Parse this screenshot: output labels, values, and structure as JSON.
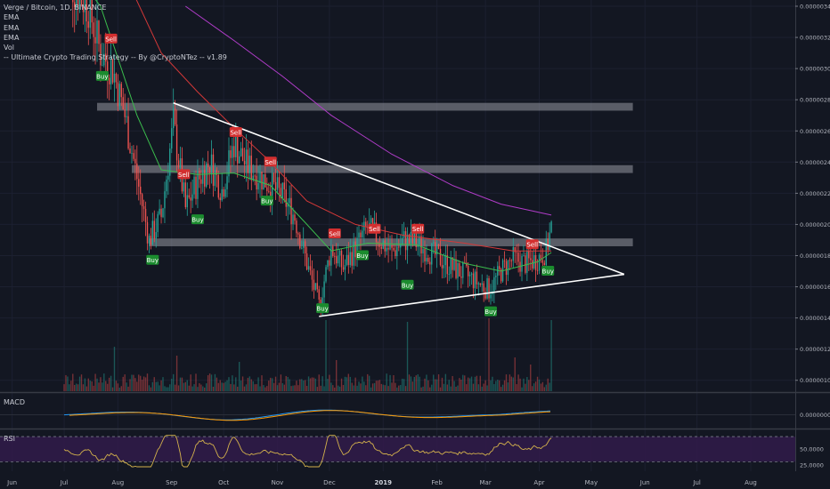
{
  "header": {
    "title": "Verge / Bitcoin, 1D, BINANCE",
    "indicators": [
      "EMA",
      "EMA",
      "EMA",
      "Vol",
      "-- Ultimate Crypto Trading Strategy -- By @CryptoNTez -- v1.89"
    ]
  },
  "panes": {
    "macd_label": "MACD",
    "rsi_label": "RSI"
  },
  "colors": {
    "background": "#131722",
    "up": "#26a69a",
    "down": "#ef5350",
    "ema_fast": "#3bbd4d",
    "ema_mid": "#d23838",
    "ema_slow": "#b03cc8",
    "trendline": "#ffffff",
    "sell": "#d32f2f",
    "buy": "#1b8c2e",
    "macd": "#2196f3",
    "signal": "#ff9800",
    "rsi": "#d4b24c",
    "rsi_band": "#311b4a"
  },
  "chart_data": {
    "type": "candlestick",
    "title": "Verge / Bitcoin, 1D, BINANCE",
    "x_ticks": [
      "Jun",
      "Jul",
      "Aug",
      "Sep",
      "Oct",
      "Nov",
      "Dec",
      "2019",
      "Feb",
      "Mar",
      "Apr",
      "May",
      "Jun",
      "Jul",
      "Aug"
    ],
    "price_axis": {
      "ticks": [
        "0.00000340",
        "0.00000320",
        "0.00000300",
        "0.00000280",
        "0.00000260",
        "0.00000240",
        "0.00000220",
        "0.00000200",
        "0.00000180",
        "0.00000160",
        "0.00000140",
        "0.00000120",
        "0.00000100"
      ],
      "ylim": [
        9.3e-07,
        3.44e-06
      ]
    },
    "macd_axis": {
      "ticks": [
        "0.00000000"
      ]
    },
    "rsi_axis": {
      "ticks": [
        "50.0000",
        "25.0000"
      ],
      "bands": [
        70,
        30
      ],
      "ylim": [
        15,
        80
      ]
    },
    "price_path": [
      [
        "2018-07-01",
        3.6e-06
      ],
      [
        "2018-07-15",
        3.4e-06
      ],
      [
        "2018-07-22",
        3.1e-06
      ],
      [
        "2018-07-29",
        3e-06
      ],
      [
        "2018-08-05",
        2.7e-06
      ],
      [
        "2018-08-12",
        2.3e-06
      ],
      [
        "2018-08-19",
        1.9e-06
      ],
      [
        "2018-08-26",
        2.05e-06
      ],
      [
        "2018-09-02",
        2.65e-06
      ],
      [
        "2018-09-09",
        2.1e-06
      ],
      [
        "2018-09-16",
        2.28e-06
      ],
      [
        "2018-09-23",
        2.4e-06
      ],
      [
        "2018-09-30",
        2.22e-06
      ],
      [
        "2018-10-07",
        2.52e-06
      ],
      [
        "2018-10-14",
        2.38e-06
      ],
      [
        "2018-10-21",
        2.32e-06
      ],
      [
        "2018-10-28",
        2.25e-06
      ],
      [
        "2018-11-04",
        2.18e-06
      ],
      [
        "2018-11-11",
        2.05e-06
      ],
      [
        "2018-11-18",
        1.75e-06
      ],
      [
        "2018-11-25",
        1.48e-06
      ],
      [
        "2018-12-02",
        1.85e-06
      ],
      [
        "2018-12-09",
        1.72e-06
      ],
      [
        "2018-12-16",
        1.85e-06
      ],
      [
        "2018-12-23",
        1.98e-06
      ],
      [
        "2018-12-30",
        1.9e-06
      ],
      [
        "2019-01-06",
        1.82e-06
      ],
      [
        "2019-01-13",
        1.9e-06
      ],
      [
        "2019-01-20",
        1.88e-06
      ],
      [
        "2019-01-27",
        1.83e-06
      ],
      [
        "2019-02-03",
        1.78e-06
      ],
      [
        "2019-02-10",
        1.72e-06
      ],
      [
        "2019-02-17",
        1.68e-06
      ],
      [
        "2019-02-24",
        1.63e-06
      ],
      [
        "2019-03-03",
        1.58e-06
      ],
      [
        "2019-03-10",
        1.7e-06
      ],
      [
        "2019-03-17",
        1.78e-06
      ],
      [
        "2019-03-24",
        1.75e-06
      ],
      [
        "2019-03-31",
        1.78e-06
      ],
      [
        "2019-04-05",
        1.83e-06
      ],
      [
        "2019-04-08",
        1.98e-06
      ]
    ],
    "ema_fast": [
      [
        "2018-07-01",
        3.7e-06
      ],
      [
        "2018-07-22",
        3.4e-06
      ],
      [
        "2018-08-12",
        2.7e-06
      ],
      [
        "2018-08-26",
        2.35e-06
      ],
      [
        "2018-09-16",
        2.32e-06
      ],
      [
        "2018-10-07",
        2.33e-06
      ],
      [
        "2018-10-28",
        2.25e-06
      ],
      [
        "2018-11-18",
        2e-06
      ],
      [
        "2018-12-02",
        1.83e-06
      ],
      [
        "2018-12-23",
        1.88e-06
      ],
      [
        "2019-01-20",
        1.87e-06
      ],
      [
        "2019-02-17",
        1.75e-06
      ],
      [
        "2019-03-10",
        1.7e-06
      ],
      [
        "2019-03-31",
        1.76e-06
      ],
      [
        "2019-04-08",
        1.82e-06
      ]
    ],
    "ema_mid": [
      [
        "2018-08-05",
        3.6e-06
      ],
      [
        "2018-08-26",
        3.1e-06
      ],
      [
        "2018-09-16",
        2.85e-06
      ],
      [
        "2018-10-07",
        2.62e-06
      ],
      [
        "2018-10-28",
        2.4e-06
      ],
      [
        "2018-11-18",
        2.15e-06
      ],
      [
        "2018-12-16",
        2e-06
      ],
      [
        "2019-01-13",
        1.93e-06
      ],
      [
        "2019-02-17",
        1.88e-06
      ],
      [
        "2019-03-17",
        1.83e-06
      ],
      [
        "2019-04-08",
        1.83e-06
      ]
    ],
    "ema_slow": [
      [
        "2018-09-09",
        3.4e-06
      ],
      [
        "2018-10-07",
        3.18e-06
      ],
      [
        "2018-11-04",
        2.95e-06
      ],
      [
        "2018-12-02",
        2.7e-06
      ],
      [
        "2019-01-06",
        2.45e-06
      ],
      [
        "2019-02-10",
        2.25e-06
      ],
      [
        "2019-03-10",
        2.13e-06
      ],
      [
        "2019-04-08",
        2.06e-06
      ]
    ],
    "trendlines": [
      {
        "from": [
          "2018-09-02",
          2.78e-06
        ],
        "to": [
          "2019-05-20",
          1.68e-06
        ]
      },
      {
        "from": [
          "2018-11-25",
          1.41e-06
        ],
        "to": [
          "2019-05-20",
          1.68e-06
        ]
      }
    ],
    "resistance_zones": [
      {
        "from": "2018-07-20",
        "to": "2019-05-25",
        "low": 2.73e-06,
        "high": 2.78e-06
      },
      {
        "from": "2018-08-09",
        "to": "2019-05-25",
        "low": 2.33e-06,
        "high": 2.38e-06
      },
      {
        "from": "2018-08-19",
        "to": "2019-05-25",
        "low": 1.86e-06,
        "high": 1.91e-06
      }
    ],
    "signals": [
      {
        "label": "Sell",
        "date": "2018-07-28",
        "price": 3.19e-06
      },
      {
        "label": "Buy",
        "date": "2018-07-23",
        "price": 2.95e-06
      },
      {
        "label": "Buy",
        "date": "2018-08-21",
        "price": 1.77e-06
      },
      {
        "label": "Sell",
        "date": "2018-09-08",
        "price": 2.32e-06
      },
      {
        "label": "Buy",
        "date": "2018-09-16",
        "price": 2.03e-06
      },
      {
        "label": "Sell",
        "date": "2018-10-08",
        "price": 2.59e-06
      },
      {
        "label": "Sell",
        "date": "2018-10-28",
        "price": 2.4e-06
      },
      {
        "label": "Buy",
        "date": "2018-10-26",
        "price": 2.15e-06
      },
      {
        "label": "Buy",
        "date": "2018-11-27",
        "price": 1.46e-06
      },
      {
        "label": "Sell",
        "date": "2018-12-04",
        "price": 1.94e-06
      },
      {
        "label": "Buy",
        "date": "2018-12-20",
        "price": 1.8e-06
      },
      {
        "label": "Sell",
        "date": "2018-12-27",
        "price": 1.97e-06
      },
      {
        "label": "Sell",
        "date": "2019-01-21",
        "price": 1.97e-06
      },
      {
        "label": "Buy",
        "date": "2019-01-15",
        "price": 1.61e-06
      },
      {
        "label": "Buy",
        "date": "2019-03-04",
        "price": 1.44e-06
      },
      {
        "label": "Sell",
        "date": "2019-03-28",
        "price": 1.87e-06
      },
      {
        "label": "Buy",
        "date": "2019-04-06",
        "price": 1.7e-06
      }
    ],
    "volume_spikes": [
      [
        "2018-11-29",
        80
      ],
      [
        "2019-01-15",
        78
      ],
      [
        "2019-03-03",
        82
      ],
      [
        "2019-04-08",
        80
      ],
      [
        "2018-07-30",
        50
      ],
      [
        "2018-09-04",
        40
      ],
      [
        "2018-10-10",
        33
      ],
      [
        "2018-12-05",
        35
      ],
      [
        "2019-03-18",
        38
      ],
      [
        "2019-03-27",
        30
      ]
    ]
  }
}
